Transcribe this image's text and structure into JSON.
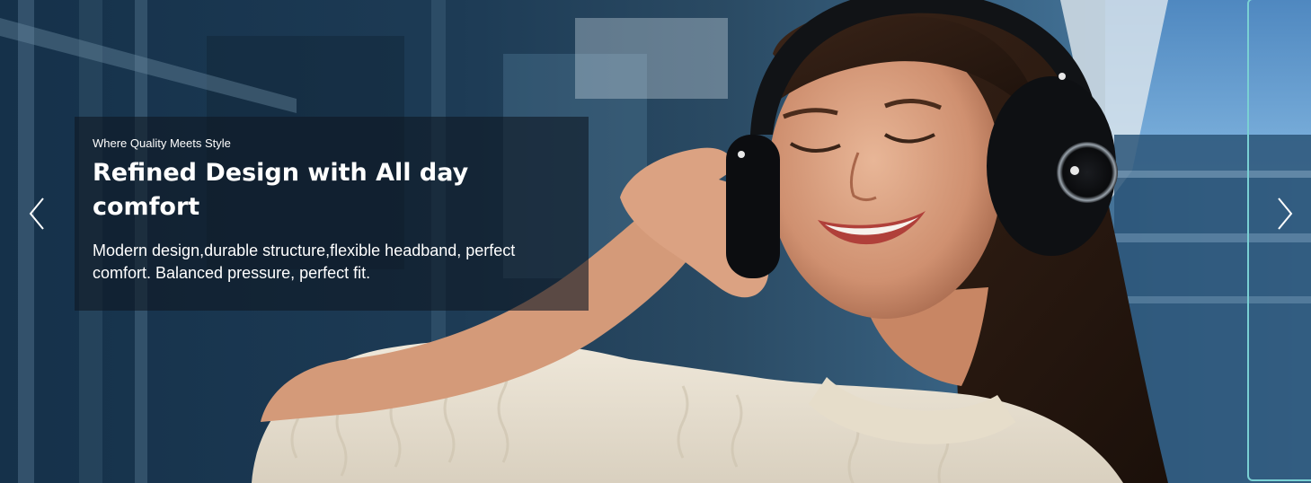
{
  "carousel": {
    "slide": {
      "eyebrow": "Where Quality Meets Style",
      "headline": "Refined Design with All day comfort",
      "body": "Modern design,durable structure,flexible headband, perfect comfort. Balanced pressure, perfect fit."
    },
    "controls": {
      "prev_icon": "chevron-left-icon",
      "next_icon": "chevron-right-icon"
    },
    "colors": {
      "caption_overlay": "#0f1923",
      "text": "#ffffff",
      "focus_ring": "#7ad0d4"
    }
  }
}
